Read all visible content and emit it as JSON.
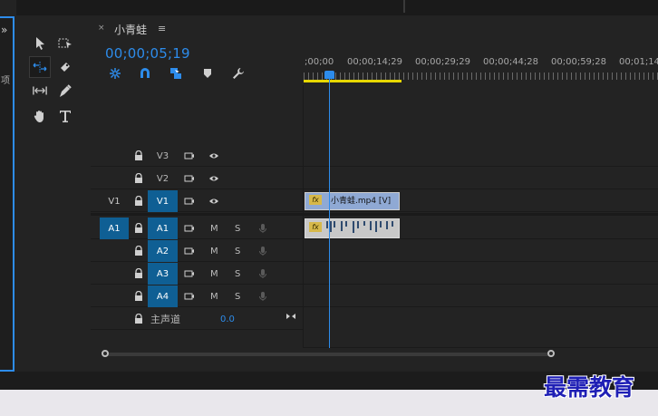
{
  "sequence": {
    "tab_title": "小青蛙",
    "timecode": "00;00;05;19",
    "ruler_labels": [
      ";00;00",
      "00;00;14;29",
      "00;00;29;29",
      "00;00;44;28",
      "00;00;59;28",
      "00;01;14"
    ]
  },
  "tracks": {
    "video": [
      {
        "name": "V3",
        "source": "",
        "active": false
      },
      {
        "name": "V2",
        "source": "",
        "active": false
      },
      {
        "name": "V1",
        "source": "V1",
        "active": true
      }
    ],
    "audio": [
      {
        "name": "A1",
        "source": "A1",
        "active": true
      },
      {
        "name": "A2",
        "source": "",
        "active": true
      },
      {
        "name": "A3",
        "source": "",
        "active": true
      },
      {
        "name": "A4",
        "source": "",
        "active": true
      }
    ],
    "mute_label": "M",
    "solo_label": "S",
    "master": {
      "name": "主声道",
      "value": "0.0"
    }
  },
  "clips": {
    "video_clip_label": "小青蛙.mp4 [V]",
    "fx_label": "fx"
  },
  "watermark": "最需教育",
  "colors": {
    "accent": "#2d8ceb",
    "track_active": "#0f5f94",
    "clip_video": "#8fa9d4",
    "work_area": "#e7d700"
  }
}
